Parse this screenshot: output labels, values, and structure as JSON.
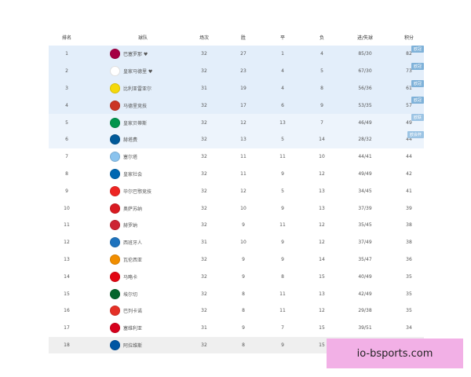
{
  "headers": {
    "rank": "排名",
    "team": "球队",
    "played": "场次",
    "won": "胜",
    "drawn": "平",
    "lost": "负",
    "goals": "进/失球",
    "points": "积分"
  },
  "rows": [
    {
      "rank": "1",
      "team": "巴塞罗那 ♥",
      "badge_color": "#a50044",
      "played": "32",
      "won": "27",
      "drawn": "1",
      "lost": "4",
      "goals": "85/30",
      "points": "82",
      "highlight": "blue",
      "tag": "欧冠"
    },
    {
      "rank": "2",
      "team": "皇家马德里 ♥",
      "badge_color": "#ffffff",
      "played": "32",
      "won": "23",
      "drawn": "4",
      "lost": "5",
      "goals": "67/30",
      "points": "73",
      "highlight": "blue",
      "tag": "欧冠"
    },
    {
      "rank": "3",
      "team": "比利亚雷亚尔",
      "badge_color": "#f5d90a",
      "played": "31",
      "won": "19",
      "drawn": "4",
      "lost": "8",
      "goals": "56/36",
      "points": "61",
      "highlight": "blue",
      "tag": "欧冠"
    },
    {
      "rank": "4",
      "team": "马德里竞技",
      "badge_color": "#cb3524",
      "played": "32",
      "won": "17",
      "drawn": "6",
      "lost": "9",
      "goals": "53/35",
      "points": "57",
      "highlight": "blue",
      "tag": "欧冠"
    },
    {
      "rank": "5",
      "team": "皇家贝蒂斯",
      "badge_color": "#00954c",
      "played": "32",
      "won": "12",
      "drawn": "13",
      "lost": "7",
      "goals": "46/49",
      "points": "49",
      "highlight": "light",
      "tag": "欧联"
    },
    {
      "rank": "6",
      "team": "赫塔费",
      "badge_color": "#005999",
      "played": "32",
      "won": "13",
      "drawn": "5",
      "lost": "14",
      "goals": "28/32",
      "points": "44",
      "highlight": "light",
      "tag": "欧会杯"
    },
    {
      "rank": "7",
      "team": "塞尔塔",
      "badge_color": "#8ac3ee",
      "played": "32",
      "won": "11",
      "drawn": "11",
      "lost": "10",
      "goals": "44/41",
      "points": "44",
      "highlight": "",
      "tag": ""
    },
    {
      "rank": "8",
      "team": "皇家社会",
      "badge_color": "#0067b1",
      "played": "32",
      "won": "11",
      "drawn": "9",
      "lost": "12",
      "goals": "49/49",
      "points": "42",
      "highlight": "",
      "tag": ""
    },
    {
      "rank": "9",
      "team": "毕尔巴鄂竞技",
      "badge_color": "#ee2523",
      "played": "32",
      "won": "12",
      "drawn": "5",
      "lost": "13",
      "goals": "34/45",
      "points": "41",
      "highlight": "",
      "tag": ""
    },
    {
      "rank": "10",
      "team": "奥萨苏纳",
      "badge_color": "#d91a21",
      "played": "32",
      "won": "10",
      "drawn": "9",
      "lost": "13",
      "goals": "37/39",
      "points": "39",
      "highlight": "",
      "tag": ""
    },
    {
      "rank": "11",
      "team": "赫罗纳",
      "badge_color": "#cd2534",
      "played": "32",
      "won": "9",
      "drawn": "11",
      "lost": "12",
      "goals": "35/45",
      "points": "38",
      "highlight": "",
      "tag": ""
    },
    {
      "rank": "12",
      "team": "西班牙人",
      "badge_color": "#1e73be",
      "played": "31",
      "won": "10",
      "drawn": "9",
      "lost": "12",
      "goals": "37/49",
      "points": "38",
      "highlight": "",
      "tag": ""
    },
    {
      "rank": "13",
      "team": "瓦伦西亚",
      "badge_color": "#f18e00",
      "played": "32",
      "won": "9",
      "drawn": "9",
      "lost": "14",
      "goals": "35/47",
      "points": "36",
      "highlight": "",
      "tag": ""
    },
    {
      "rank": "14",
      "team": "马略卡",
      "badge_color": "#e20613",
      "played": "32",
      "won": "9",
      "drawn": "8",
      "lost": "15",
      "goals": "40/49",
      "points": "35",
      "highlight": "",
      "tag": ""
    },
    {
      "rank": "15",
      "team": "埃尔切",
      "badge_color": "#05642c",
      "played": "32",
      "won": "8",
      "drawn": "11",
      "lost": "13",
      "goals": "42/49",
      "points": "35",
      "highlight": "",
      "tag": ""
    },
    {
      "rank": "16",
      "team": "巴列卡诺",
      "badge_color": "#e53027",
      "played": "32",
      "won": "8",
      "drawn": "11",
      "lost": "12",
      "goals": "29/38",
      "points": "35",
      "highlight": "",
      "tag": ""
    },
    {
      "rank": "17",
      "team": "塞维利亚",
      "badge_color": "#d6001c",
      "played": "31",
      "won": "9",
      "drawn": "7",
      "lost": "15",
      "goals": "39/51",
      "points": "34",
      "highlight": "",
      "tag": ""
    },
    {
      "rank": "18",
      "team": "阿拉维斯",
      "badge_color": "#0056a3",
      "played": "32",
      "won": "8",
      "drawn": "9",
      "lost": "15",
      "goals": "36/48",
      "points": "33",
      "highlight": "gray",
      "tag": ""
    }
  ],
  "watermark": "io-bsports.com"
}
